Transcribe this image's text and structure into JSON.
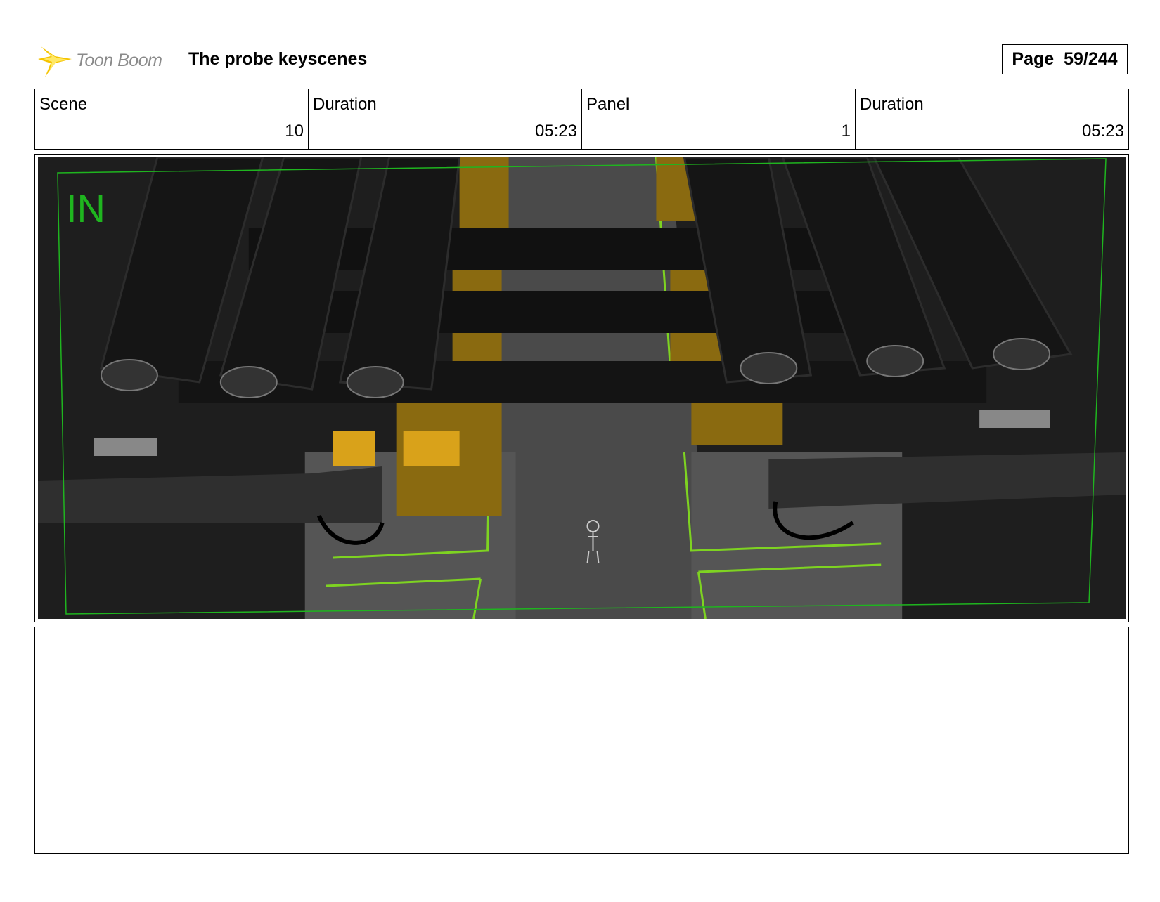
{
  "header": {
    "logo_text": "Toon Boom",
    "project_title": "The probe keyscenes",
    "page_label": "Page",
    "page_value": "59/244"
  },
  "info": [
    {
      "label": "Scene",
      "value": "10"
    },
    {
      "label": "Duration",
      "value": "05:23"
    },
    {
      "label": "Panel",
      "value": "1"
    },
    {
      "label": "Duration",
      "value": "05:23"
    }
  ],
  "panel": {
    "overlay_label": "IN",
    "colors": {
      "safe_frame": "#1fb51f",
      "floor_line": "#7ed321",
      "cargo": "#b8860b"
    }
  },
  "notes": {
    "text": ""
  }
}
